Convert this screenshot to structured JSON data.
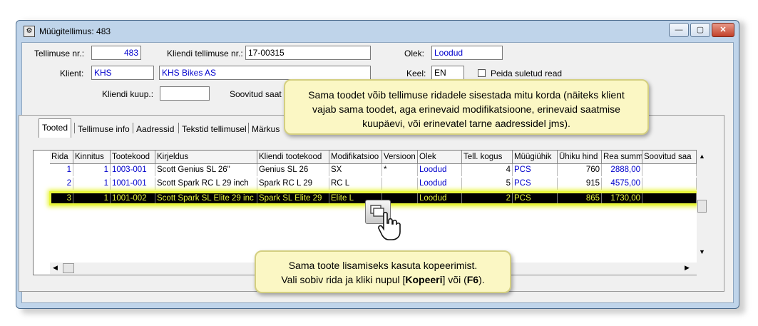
{
  "window": {
    "title": "Müügitellimus: 483",
    "minimize_label": "—",
    "restore_label": "▢",
    "close_label": "✕"
  },
  "form": {
    "order_no_label": "Tellimuse nr.:",
    "order_no_value": "483",
    "client_order_no_label": "Kliendi tellimuse nr.:",
    "client_order_no_value": "17-00315",
    "status_label": "Olek:",
    "status_value": "Loodud",
    "client_label": "Klient:",
    "client_code": "KHS",
    "client_name": "KHS Bikes AS",
    "language_label": "Keel:",
    "language_value": "EN",
    "hide_closed_label": "Peida suletud read",
    "client_date_label": "Kliendi kuup.:",
    "client_date_value": "",
    "desired_ship_label": "Soovitud saat"
  },
  "tabs": [
    "Tooted",
    "Tellimuse info",
    "Aadressid",
    "Tekstid tellimusel",
    "Märkus"
  ],
  "grid": {
    "headers": [
      "Rida",
      "Kinnitus",
      "Tootekood",
      "Kirjeldus",
      "Kliendi tootekood",
      "Modifikatsioo",
      "Versioon",
      "Olek",
      "Tell. kogus",
      "Müügiühik",
      "Ühiku hind",
      "Rea summ",
      "Soovitud saa"
    ],
    "rows": [
      [
        "1",
        "1",
        "1003-001",
        "Scott Genius SL 26\"",
        "Genius SL 26",
        "SX",
        "*",
        "Loodud",
        "4",
        "PCS",
        "760",
        "2888,00",
        ""
      ],
      [
        "2",
        "1",
        "1001-001",
        "Scott Spark RC L 29 inch",
        "Spark RC L 29",
        "RC L",
        "",
        "Loodud",
        "5",
        "PCS",
        "915",
        "4575,00",
        ""
      ],
      [
        "3",
        "1",
        "1001-002",
        "Scott Spark SL Elite 29 inc",
        "Spark SL Elite 29",
        "Elite L",
        "",
        "Loodud",
        "2",
        "PCS",
        "865",
        "1730,00",
        ""
      ]
    ]
  },
  "callouts": {
    "top": "Sama toodet võib tellimuse ridadele sisestada mitu korda (näiteks klient vajab sama toodet, aga erinevaid modifikatsioone, erinevaid saatmise kuupäevi, või erinevatel tarne aadressidel jms).",
    "bottom_line1": "Sama toote lisamiseks kasuta kopeerimist.",
    "bottom_line2_pre": "Vali sobiv rida ja kliki nupul [",
    "bottom_line2_bold1": "Kopeeri",
    "bottom_line2_mid": "] või (",
    "bottom_line2_bold2": "F6",
    "bottom_line2_post": ")."
  },
  "colors": {
    "link_blue": "#0000cc",
    "highlight_yellow": "#e8f53a",
    "callout_bg": "#fbf7c4"
  },
  "icons": [
    "window-app-icon",
    "copy-button-icon",
    "hand-cursor-icon"
  ]
}
